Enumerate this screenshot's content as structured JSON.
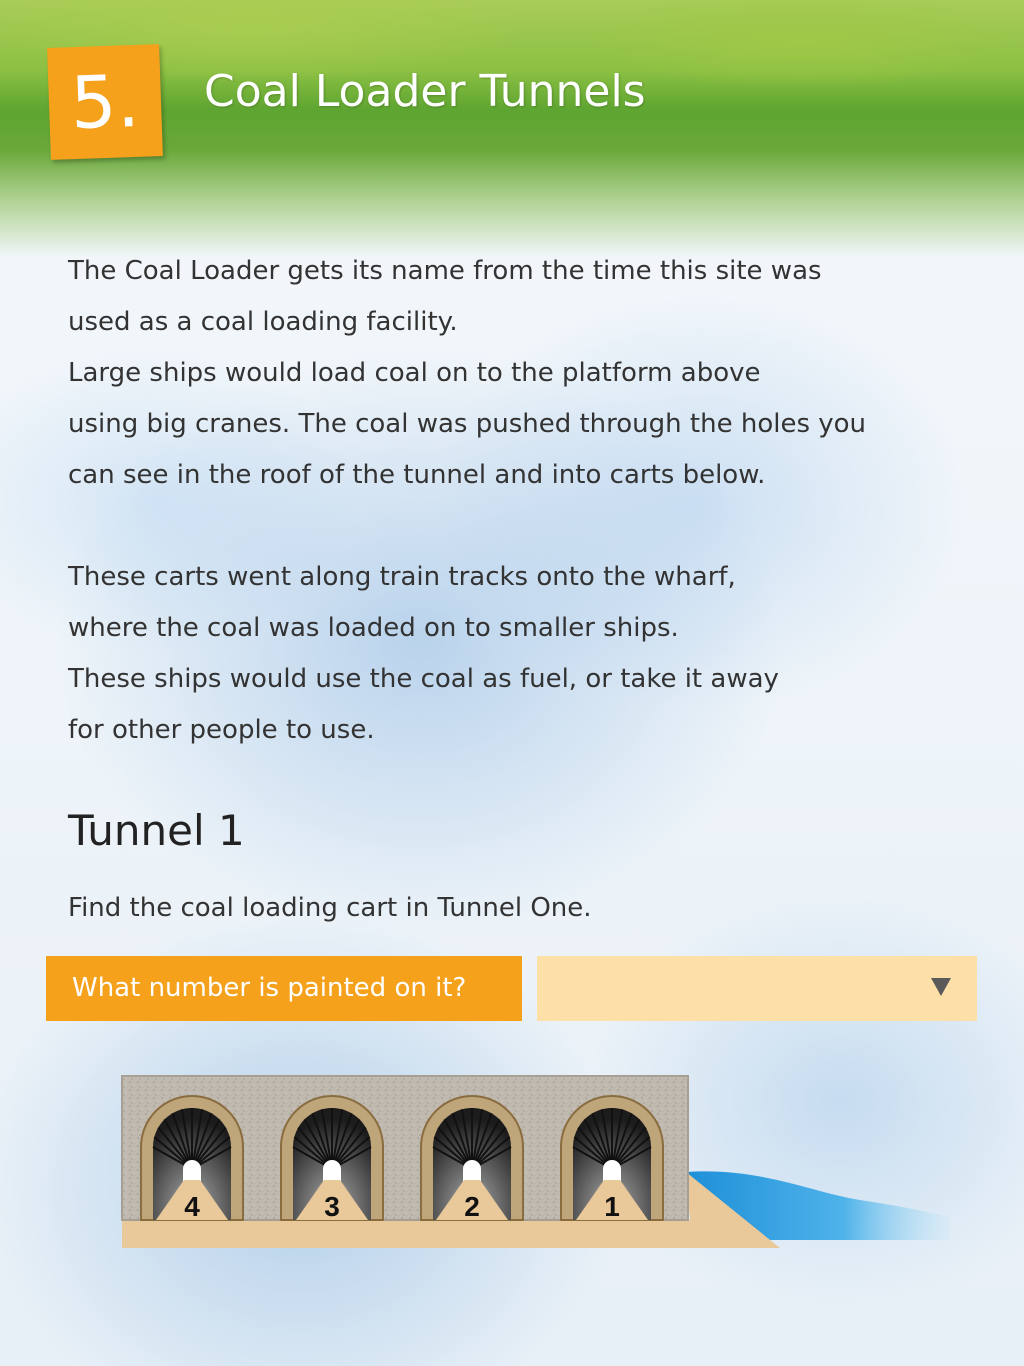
{
  "header": {
    "badge": "5.",
    "title": "Coal Loader Tunnels"
  },
  "intro": {
    "lines": [
      "The Coal Loader gets its name from the time this site was",
      "used as a coal loading facility.",
      "Large ships would load coal on to the platform above",
      "using big cranes. The coal was pushed through the holes you",
      "can see in the roof of the tunnel and into carts below."
    ]
  },
  "details": {
    "lines": [
      "These carts went along train tracks onto the wharf,",
      "where the coal was loaded on to smaller ships.",
      "These ships would use the coal as fuel, or take it away",
      "for other people to use."
    ]
  },
  "section": {
    "title": "Tunnel 1",
    "instruction": "Find the coal loading cart in Tunnel One."
  },
  "question": {
    "label": "What number is painted on it?",
    "selected_value": ""
  },
  "diagram": {
    "tunnel_numbers": [
      "4",
      "3",
      "2",
      "1"
    ]
  },
  "colors": {
    "accent": "#f5a11b",
    "select_bg": "#fde0a8",
    "water": "#2f9fe0",
    "ground": "#e9c99a",
    "wall": "#bdb7ad"
  }
}
